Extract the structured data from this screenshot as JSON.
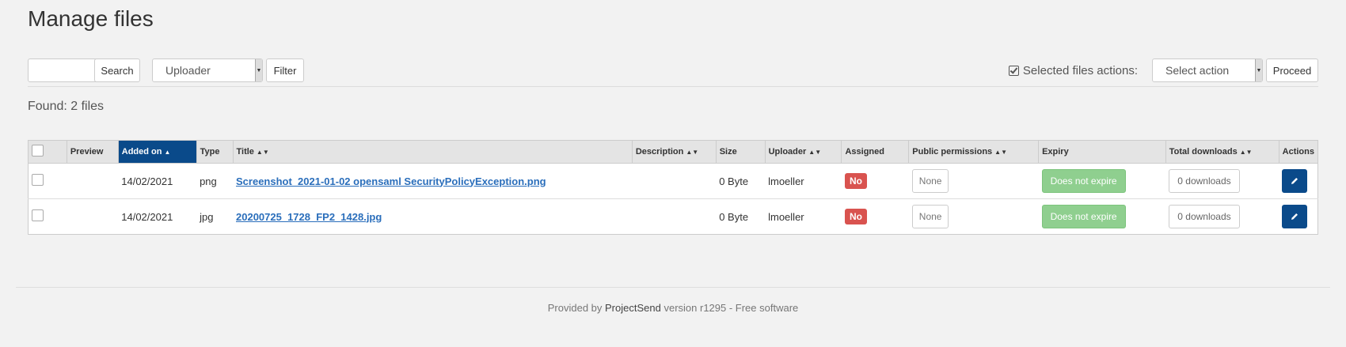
{
  "page": {
    "title": "Manage files"
  },
  "toolbar": {
    "search_value": "",
    "search_label": "Search",
    "uploader_select": "Uploader",
    "filter_label": "Filter",
    "actions_label": "Selected files actions:",
    "action_select": "Select action",
    "proceed_label": "Proceed"
  },
  "found": "Found: 2 files",
  "table": {
    "headers": {
      "preview": "Preview",
      "added_on": "Added on",
      "type": "Type",
      "title": "Title",
      "description": "Description",
      "size": "Size",
      "uploader": "Uploader",
      "assigned": "Assigned",
      "public_permissions": "Public permissions",
      "expiry": "Expiry",
      "total_downloads": "Total downloads",
      "actions": "Actions"
    },
    "rows": [
      {
        "added_on": "14/02/2021",
        "type": "png",
        "title": "Screenshot_2021-01-02 opensaml SecurityPolicyException.png",
        "description": "",
        "size": "0 Byte",
        "uploader": "lmoeller",
        "assigned": "No",
        "public_permissions": "None",
        "expiry": "Does not expire",
        "total_downloads": "0 downloads"
      },
      {
        "added_on": "14/02/2021",
        "type": "jpg",
        "title": "20200725_1728_FP2_1428.jpg",
        "description": "",
        "size": "0 Byte",
        "uploader": "lmoeller",
        "assigned": "No",
        "public_permissions": "None",
        "expiry": "Does not expire",
        "total_downloads": "0 downloads"
      }
    ]
  },
  "footer": {
    "prefix": "Provided by",
    "brand": "ProjectSend",
    "suffix": "version r1295 - Free software"
  },
  "colors": {
    "primary": "#0a4a8a",
    "danger": "#d9534f",
    "success": "#8fcf8f",
    "link": "#2a6ebb"
  }
}
